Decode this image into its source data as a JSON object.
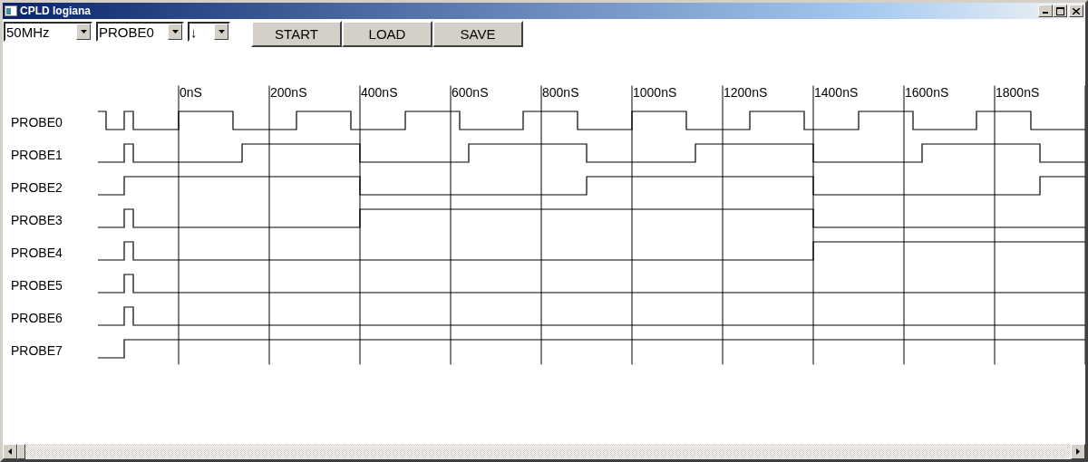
{
  "window": {
    "title": "CPLD logiana"
  },
  "toolbar": {
    "dropdowns": [
      {
        "value": "50MHz"
      },
      {
        "value": "PROBE0"
      },
      {
        "value": "↓"
      }
    ],
    "buttons": [
      "START",
      "LOAD",
      "SAVE"
    ]
  },
  "time_axis": {
    "labels": [
      "0nS",
      "200nS",
      "400nS",
      "600nS",
      "800nS",
      "1000nS",
      "1200nS",
      "1400nS",
      "1600nS",
      "1800nS"
    ]
  },
  "probes": [
    {
      "name": "PROBE0"
    },
    {
      "name": "PROBE1"
    },
    {
      "name": "PROBE2"
    },
    {
      "name": "PROBE3"
    },
    {
      "name": "PROBE4"
    },
    {
      "name": "PROBE5"
    },
    {
      "name": "PROBE6"
    },
    {
      "name": "PROBE7"
    }
  ]
}
